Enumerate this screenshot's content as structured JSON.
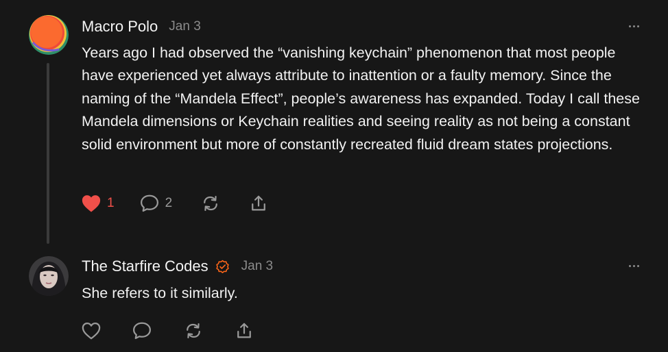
{
  "colors": {
    "background": "#171717",
    "text": "#f2f2f2",
    "muted": "#8b8b8b",
    "like_active": "#f0504a",
    "verified": "#ff6719"
  },
  "comments": [
    {
      "author": "Macro Polo",
      "date": "Jan 3",
      "verified": false,
      "body": "Years ago I had observed the “vanishing keychain” phenomenon that most people have experienced yet always attribute to inattention or a faulty memory. Since the naming of the “Mandela Effect”, people’s awareness has expanded. Today I call these Mandela dimensions or Keychain realities and seeing reality as not being a constant solid environment but more of constantly recreated fluid dream states projections.",
      "likes": "1",
      "liked": true,
      "replies": "2",
      "icons": [
        "heart-icon",
        "comment-icon",
        "restack-icon",
        "share-icon",
        "more-icon"
      ]
    },
    {
      "author": "The Starfire Codes",
      "date": "Jan 3",
      "verified": true,
      "body": "She refers to it similarly.",
      "likes": "",
      "liked": false,
      "replies": "",
      "icons": [
        "heart-icon",
        "comment-icon",
        "restack-icon",
        "share-icon",
        "more-icon"
      ]
    }
  ]
}
